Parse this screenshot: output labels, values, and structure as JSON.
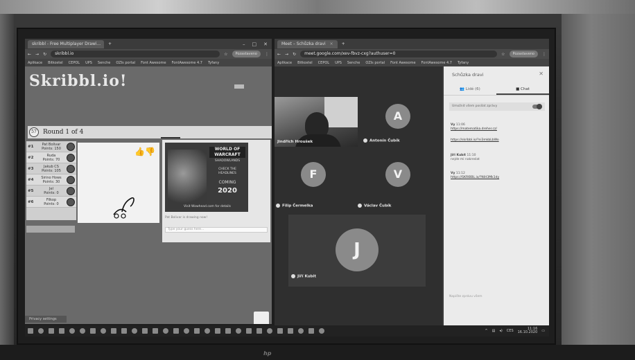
{
  "left_window": {
    "tab_title": "skribbl - Free Multiplayer Drawi...",
    "tab_close": "×",
    "tab_new": "+",
    "controls": [
      "–",
      "□",
      "✕"
    ],
    "address": "skribbl.io",
    "profile": "Pozastaveno",
    "bookmarks": [
      "Aplikace",
      "Bitkostel",
      "CEPOL",
      "UPS",
      "Senche",
      "OZIs portal",
      "Font Awesome",
      "FontAwesome 4.7",
      "Tyfany"
    ],
    "logo": "Skribbl.io!",
    "round_label": "Round 1 of 4",
    "clock": "57",
    "players": [
      {
        "rank": "#1",
        "name": "Pat Bolivar",
        "points": "Points: 150"
      },
      {
        "rank": "#2",
        "name": "Ruda",
        "points": "Points: 70"
      },
      {
        "rank": "#3",
        "name": "Jakub CS",
        "points": "Points: 105"
      },
      {
        "rank": "#4",
        "name": "Sirino Hows",
        "points": "Points: 30"
      },
      {
        "rank": "#5",
        "name": "Jel",
        "points": "Points: 0"
      },
      {
        "rank": "#6",
        "name": "Filkop",
        "points": "Points: 0"
      }
    ],
    "ad": {
      "brand": "WORLD OF WARCRAFT",
      "sub": "SHADOWLANDS",
      "line1": "CHECK THE",
      "line2": "HEADLINES",
      "coming": "COMING",
      "year": "2020",
      "footer": "Visit Wowhead.com for details"
    },
    "chat_log": "Pat Bolivar is drawing now!",
    "chat_placeholder": "Type your guess here...",
    "privacy": "Privacy settings"
  },
  "right_window": {
    "tab_title": "Meet – Schůzka dravi",
    "tab_close": "×",
    "tab_new": "+",
    "address": "meet.google.com/xev-fbvz-cxg?authuser=0",
    "profile": "Pozastaveno",
    "bookmarks": [
      "Aplikace",
      "Bitkostel",
      "CEPOL",
      "UPS",
      "Senche",
      "OZIs portal",
      "Font Awesome",
      "FontAwesome 4.7",
      "Tyfany"
    ],
    "participants": {
      "cam_name": "Jindřich Hroušek",
      "a_letter": "A",
      "a_name": "Antonín Čubík",
      "f_letter": "F",
      "f_name": "Filip Čermelka",
      "v_letter": "V",
      "v_name": "Václav Čubík",
      "j_letter": "J",
      "j_name": "Jiří Kubit"
    },
    "panel": {
      "title": "Schůzka dravi",
      "close": "✕",
      "tab_people": "Lidé (6)",
      "tab_chat": "Chat",
      "toggle_label": "Umožnit všem posílat zprávy",
      "messages": [
        {
          "who": "Vy",
          "time": "11:06",
          "text": "https://matematika.dreher.cz/"
        },
        {
          "who": "",
          "time": "",
          "text": "https://skribbl.io/?ni3mkbLbWo"
        },
        {
          "who": "Jiří Kubít",
          "time": "11:10",
          "text": "nejde mi nakreslat"
        },
        {
          "who": "Vy",
          "time": "11:12",
          "text": "https://SKRIBBL.io/?NiH3Mk1dy"
        }
      ],
      "send_placeholder": "Napište zprávu všem"
    }
  },
  "taskbar": {
    "time": "11:16",
    "date": "16.10.2020",
    "lang": "CES"
  },
  "brand": "hp"
}
